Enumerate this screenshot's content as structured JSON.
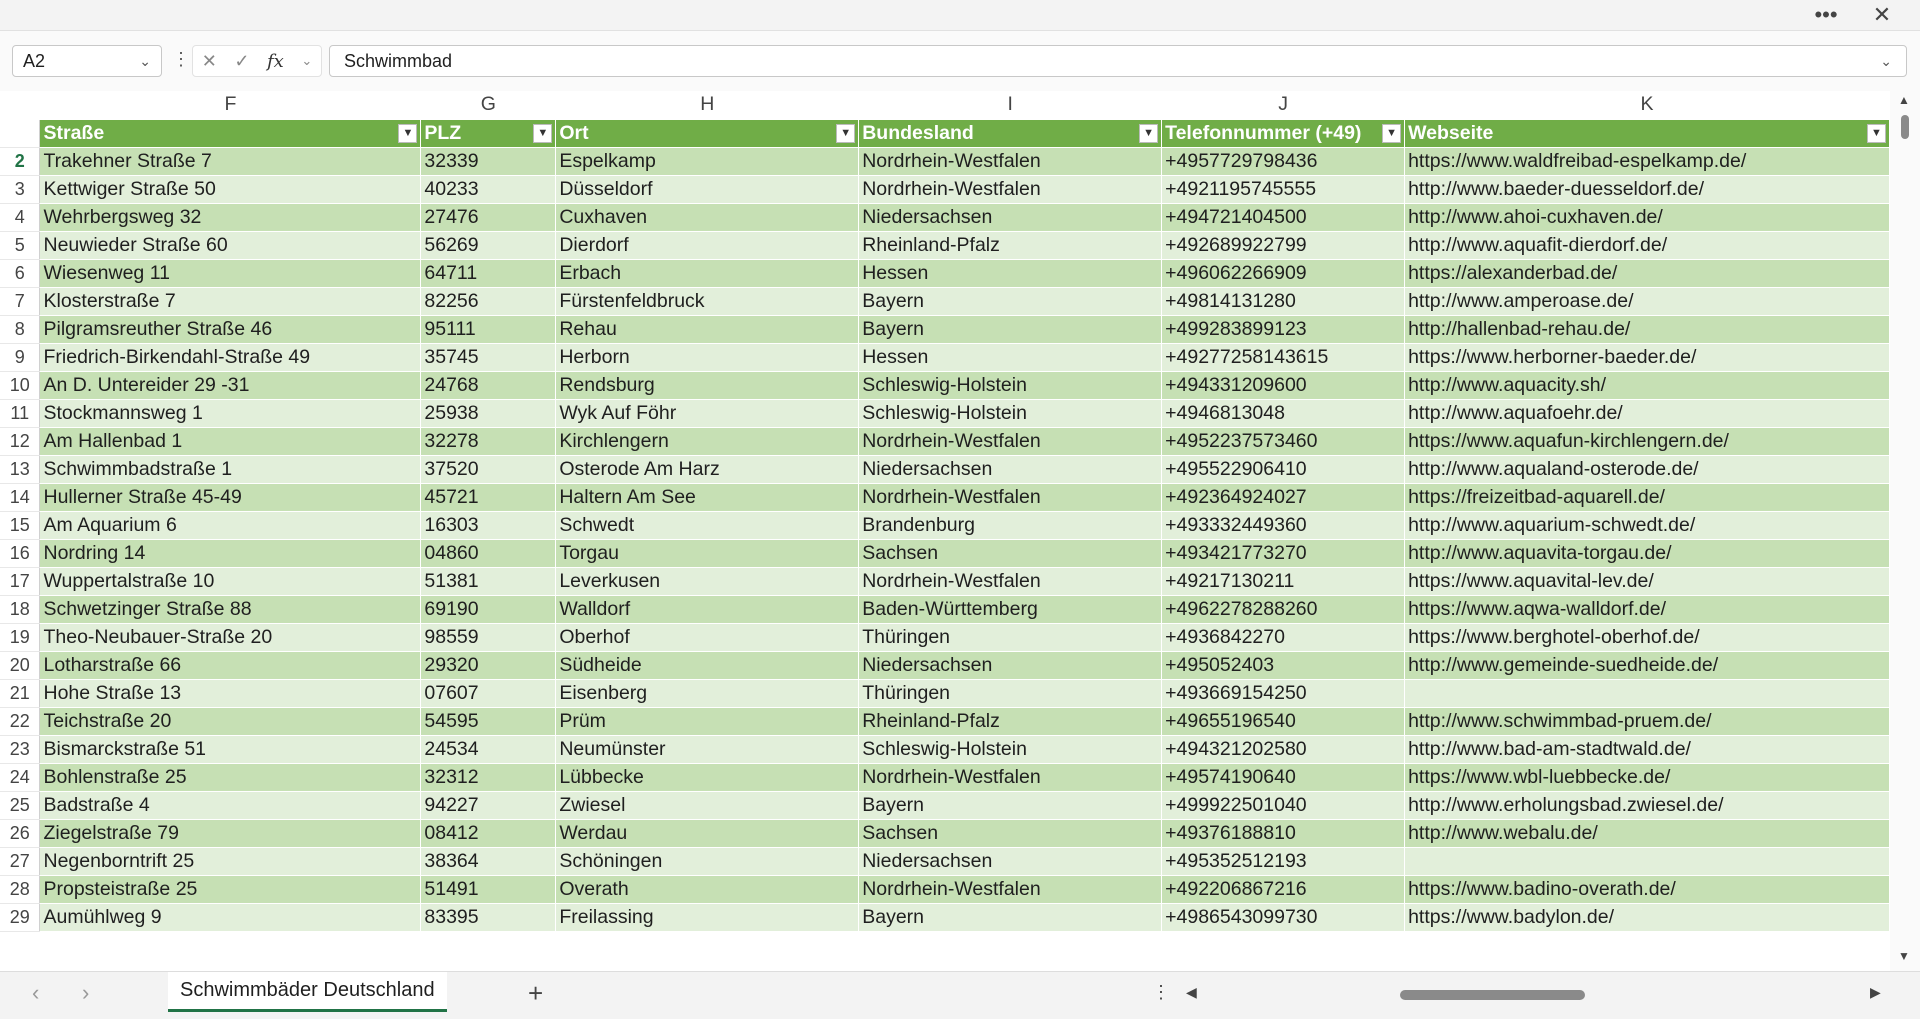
{
  "window": {
    "more_glyph": "•••",
    "close_glyph": "✕"
  },
  "formula_bar": {
    "name_box": "A2",
    "formula": "Schwimmbad"
  },
  "columns": [
    "F",
    "G",
    "H",
    "I",
    "J",
    "K"
  ],
  "header": [
    "Straße",
    "PLZ",
    "Ort",
    "Bundesland",
    "Telefonnummer (+49)",
    "Webseite"
  ],
  "rows": [
    [
      "2",
      "Trakehner Straße 7",
      "32339",
      "Espelkamp",
      "Nordrhein-Westfalen",
      "+4957729798436",
      "https://www.waldfreibad-espelkamp.de/"
    ],
    [
      "3",
      "Kettwiger Straße 50",
      "40233",
      "Düsseldorf",
      "Nordrhein-Westfalen",
      "+4921195745555",
      "http://www.baeder-duesseldorf.de/"
    ],
    [
      "4",
      "Wehrbergsweg 32",
      "27476",
      "Cuxhaven",
      "Niedersachsen",
      "+494721404500",
      "http://www.ahoi-cuxhaven.de/"
    ],
    [
      "5",
      "Neuwieder Straße 60",
      "56269",
      "Dierdorf",
      "Rheinland-Pfalz",
      "+492689922799",
      "http://www.aquafit-dierdorf.de/"
    ],
    [
      "6",
      "Wiesenweg 11",
      "64711",
      "Erbach",
      "Hessen",
      "+496062266909",
      "https://alexanderbad.de/"
    ],
    [
      "7",
      "Klosterstraße 7",
      "82256",
      "Fürstenfeldbruck",
      "Bayern",
      "+49814131280",
      "http://www.amperoase.de/"
    ],
    [
      "8",
      "Pilgramsreuther Straße 46",
      "95111",
      "Rehau",
      "Bayern",
      "+499283899123",
      "http://hallenbad-rehau.de/"
    ],
    [
      "9",
      "Friedrich-Birkendahl-Straße 49",
      "35745",
      "Herborn",
      "Hessen",
      "+49277258143615",
      "https://www.herborner-baeder.de/"
    ],
    [
      "10",
      "An D. Untereider 29 -31",
      "24768",
      "Rendsburg",
      "Schleswig-Holstein",
      "+494331209600",
      "http://www.aquacity.sh/"
    ],
    [
      "11",
      "Stockmannsweg 1",
      "25938",
      "Wyk Auf Föhr",
      "Schleswig-Holstein",
      "+4946813048",
      "http://www.aquafoehr.de/"
    ],
    [
      "12",
      "Am Hallenbad 1",
      "32278",
      "Kirchlengern",
      "Nordrhein-Westfalen",
      "+4952237573460",
      "https://www.aquafun-kirchlengern.de/"
    ],
    [
      "13",
      "Schwimmbadstraße 1",
      "37520",
      "Osterode Am Harz",
      "Niedersachsen",
      "+495522906410",
      "http://www.aqualand-osterode.de/"
    ],
    [
      "14",
      "Hullerner Straße 45-49",
      "45721",
      "Haltern Am See",
      "Nordrhein-Westfalen",
      "+492364924027",
      "https://freizeitbad-aquarell.de/"
    ],
    [
      "15",
      "Am Aquarium 6",
      "16303",
      "Schwedt",
      "Brandenburg",
      "+493332449360",
      "http://www.aquarium-schwedt.de/"
    ],
    [
      "16",
      "Nordring 14",
      "04860",
      "Torgau",
      "Sachsen",
      "+493421773270",
      "http://www.aquavita-torgau.de/"
    ],
    [
      "17",
      "Wuppertalstraße 10",
      "51381",
      "Leverkusen",
      "Nordrhein-Westfalen",
      "+49217130211",
      "https://www.aquavital-lev.de/"
    ],
    [
      "18",
      "Schwetzinger Straße 88",
      "69190",
      "Walldorf",
      "Baden-Württemberg",
      "+4962278288260",
      "https://www.aqwa-walldorf.de/"
    ],
    [
      "19",
      "Theo-Neubauer-Straße 20",
      "98559",
      "Oberhof",
      "Thüringen",
      "+4936842270",
      "https://www.berghotel-oberhof.de/"
    ],
    [
      "20",
      "Lotharstraße 66",
      "29320",
      "Südheide",
      "Niedersachsen",
      "+495052403",
      "http://www.gemeinde-suedheide.de/"
    ],
    [
      "21",
      "Hohe Straße 13",
      "07607",
      "Eisenberg",
      "Thüringen",
      "+493669154250",
      ""
    ],
    [
      "22",
      "Teichstraße 20",
      "54595",
      "Prüm",
      "Rheinland-Pfalz",
      "+49655196540",
      "http://www.schwimmbad-pruem.de/"
    ],
    [
      "23",
      "Bismarckstraße 51",
      "24534",
      "Neumünster",
      "Schleswig-Holstein",
      "+494321202580",
      "http://www.bad-am-stadtwald.de/"
    ],
    [
      "24",
      "Bohlenstraße 25",
      "32312",
      "Lübbecke",
      "Nordrhein-Westfalen",
      "+49574190640",
      "https://www.wbl-luebbecke.de/"
    ],
    [
      "25",
      "Badstraße 4",
      "94227",
      "Zwiesel",
      "Bayern",
      "+499922501040",
      "http://www.erholungsbad.zwiesel.de/"
    ],
    [
      "26",
      "Ziegelstraße 79",
      "08412",
      "Werdau",
      "Sachsen",
      "+49376188810",
      "http://www.webalu.de/"
    ],
    [
      "27",
      "Negenborntrift 25",
      "38364",
      "Schöningen",
      "Niedersachsen",
      "+495352512193",
      ""
    ],
    [
      "28",
      "Propsteistraße 25",
      "51491",
      "Overath",
      "Nordrhein-Westfalen",
      "+492206867216",
      "https://www.badino-overath.de/"
    ],
    [
      "29",
      "Aumühlweg 9",
      "83395",
      "Freilassing",
      "Bayern",
      "+4986543099730",
      "https://www.badylon.de/"
    ]
  ],
  "sheet_tab": "Schwimmbäder Deutschland",
  "colors": {
    "header_green": "#70ad47",
    "band_dark": "#c6e0b4",
    "band_light": "#e2efda",
    "accent": "#217346"
  }
}
